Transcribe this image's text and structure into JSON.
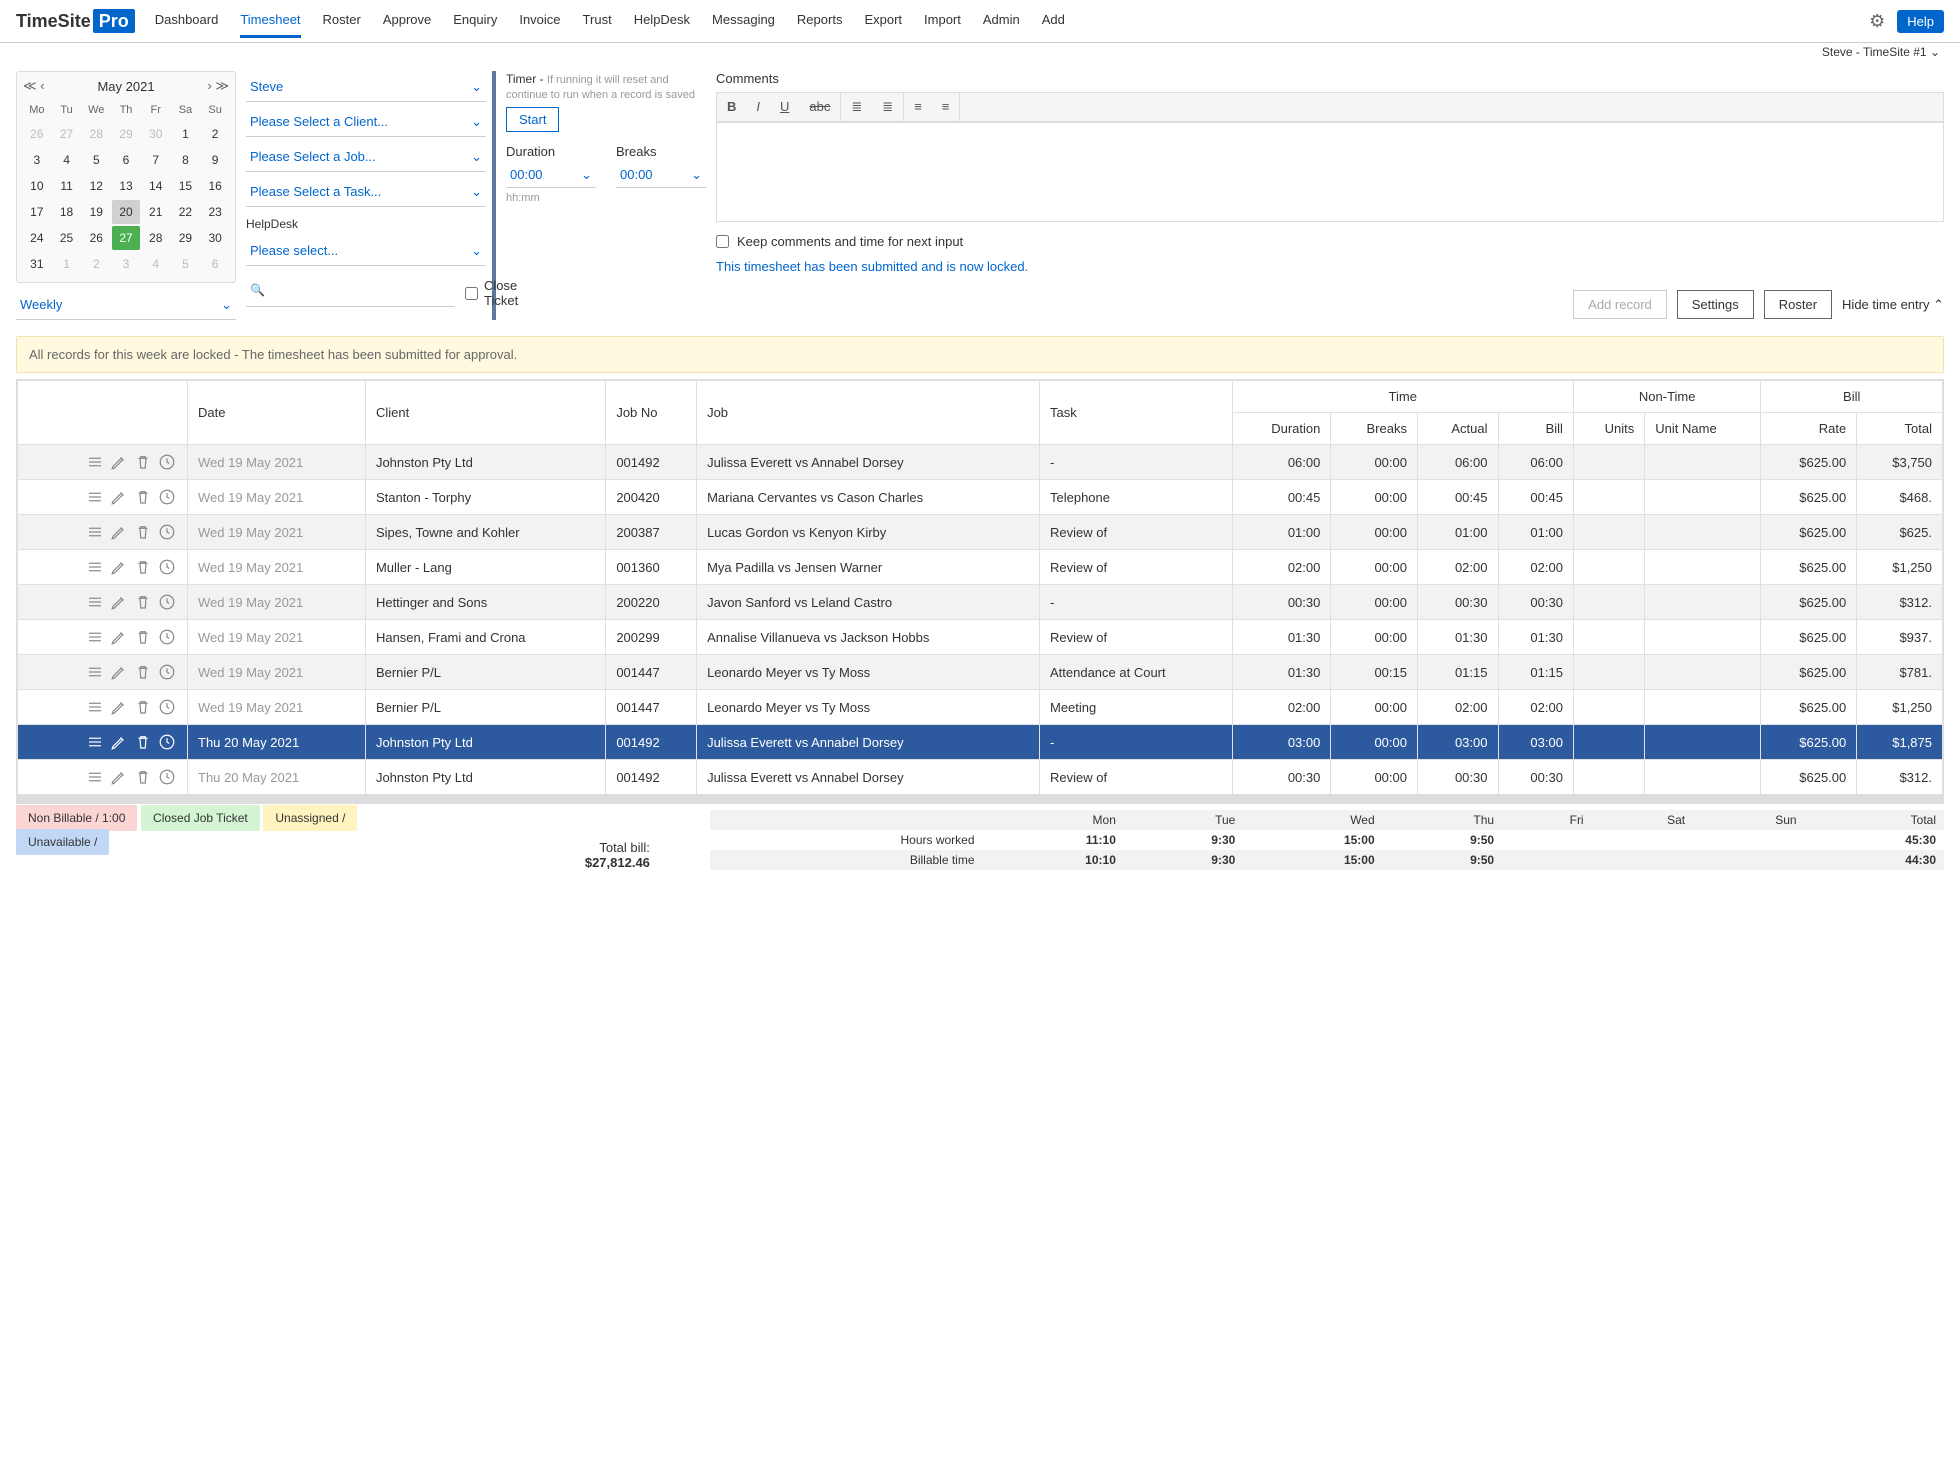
{
  "header": {
    "logo_a": "TimeSite",
    "logo_b": "Pro",
    "nav": [
      "Dashboard",
      "Timesheet",
      "Roster",
      "Approve",
      "Enquiry",
      "Invoice",
      "Trust",
      "HelpDesk",
      "Messaging",
      "Reports",
      "Export",
      "Import",
      "Admin",
      "Add"
    ],
    "active_nav": "Timesheet",
    "help": "Help",
    "user": "Steve - TimeSite #1"
  },
  "calendar": {
    "title": "May 2021",
    "dow": [
      "Mo",
      "Tu",
      "We",
      "Th",
      "Fr",
      "Sa",
      "Su"
    ],
    "rows": [
      [
        {
          "d": "26",
          "o": true
        },
        {
          "d": "27",
          "o": true
        },
        {
          "d": "28",
          "o": true
        },
        {
          "d": "29",
          "o": true
        },
        {
          "d": "30",
          "o": true
        },
        {
          "d": "1"
        },
        {
          "d": "2"
        }
      ],
      [
        {
          "d": "3"
        },
        {
          "d": "4"
        },
        {
          "d": "5"
        },
        {
          "d": "6"
        },
        {
          "d": "7"
        },
        {
          "d": "8"
        },
        {
          "d": "9"
        }
      ],
      [
        {
          "d": "10"
        },
        {
          "d": "11"
        },
        {
          "d": "12"
        },
        {
          "d": "13"
        },
        {
          "d": "14"
        },
        {
          "d": "15"
        },
        {
          "d": "16"
        }
      ],
      [
        {
          "d": "17"
        },
        {
          "d": "18"
        },
        {
          "d": "19"
        },
        {
          "d": "20",
          "hl": true
        },
        {
          "d": "21"
        },
        {
          "d": "22"
        },
        {
          "d": "23"
        }
      ],
      [
        {
          "d": "24"
        },
        {
          "d": "25"
        },
        {
          "d": "26"
        },
        {
          "d": "27",
          "td": true
        },
        {
          "d": "28"
        },
        {
          "d": "29"
        },
        {
          "d": "30"
        }
      ],
      [
        {
          "d": "31"
        },
        {
          "d": "1",
          "o": true
        },
        {
          "d": "2",
          "o": true
        },
        {
          "d": "3",
          "o": true
        },
        {
          "d": "4",
          "o": true
        },
        {
          "d": "5",
          "o": true
        },
        {
          "d": "6",
          "o": true
        }
      ]
    ],
    "weekly": "Weekly"
  },
  "selectors": {
    "person": "Steve",
    "client": "Please Select a Client...",
    "job": "Please Select a Job...",
    "task": "Please Select a Task...",
    "helpdesk_label": "HelpDesk",
    "helpdesk": "Please select...",
    "close_ticket": "Close Ticket"
  },
  "timer": {
    "label": "Timer - ",
    "desc": "If running it will reset and continue to run when a record is saved",
    "start": "Start",
    "duration_label": "Duration",
    "duration_val": "00:00",
    "breaks_label": "Breaks",
    "breaks_val": "00:00",
    "hhmm": "hh:mm"
  },
  "comments": {
    "label": "Comments",
    "keep": "Keep comments and time for next input",
    "locked": "This timesheet has been submitted and is now locked.",
    "add_record": "Add record",
    "settings": "Settings",
    "roster": "Roster",
    "hide": "Hide time entry"
  },
  "banner": "All records for this week are locked - The timesheet has been submitted for approval.",
  "columns": {
    "date": "Date",
    "client": "Client",
    "jobno": "Job No",
    "job": "Job",
    "task": "Task",
    "time": "Time",
    "nontime": "Non-Time",
    "bill": "Bill",
    "duration": "Duration",
    "breaks": "Breaks",
    "actual": "Actual",
    "billcol": "Bill",
    "units": "Units",
    "unitname": "Unit Name",
    "rate": "Rate",
    "total": "Total"
  },
  "rows": [
    {
      "date": "Wed 19 May 2021",
      "client": "Johnston Pty Ltd",
      "jobno": "001492",
      "job": "Julissa Everett vs Annabel Dorsey",
      "task": "-",
      "dur": "06:00",
      "brk": "00:00",
      "act": "06:00",
      "bill": "06:00",
      "units": "",
      "un": "",
      "rate": "$625.00",
      "total": "$3,750"
    },
    {
      "date": "Wed 19 May 2021",
      "client": "Stanton - Torphy",
      "jobno": "200420",
      "job": "Mariana Cervantes vs Cason Charles",
      "task": "Telephone",
      "dur": "00:45",
      "brk": "00:00",
      "act": "00:45",
      "bill": "00:45",
      "units": "",
      "un": "",
      "rate": "$625.00",
      "total": "$468."
    },
    {
      "date": "Wed 19 May 2021",
      "client": "Sipes, Towne and Kohler",
      "jobno": "200387",
      "job": "Lucas Gordon vs Kenyon Kirby",
      "task": "Review of",
      "dur": "01:00",
      "brk": "00:00",
      "act": "01:00",
      "bill": "01:00",
      "units": "",
      "un": "",
      "rate": "$625.00",
      "total": "$625."
    },
    {
      "date": "Wed 19 May 2021",
      "client": "Muller - Lang",
      "jobno": "001360",
      "job": "Mya Padilla vs Jensen Warner",
      "task": "Review of",
      "dur": "02:00",
      "brk": "00:00",
      "act": "02:00",
      "bill": "02:00",
      "units": "",
      "un": "",
      "rate": "$625.00",
      "total": "$1,250"
    },
    {
      "date": "Wed 19 May 2021",
      "client": "Hettinger and Sons",
      "jobno": "200220",
      "job": "Javon Sanford vs Leland Castro",
      "task": "-",
      "dur": "00:30",
      "brk": "00:00",
      "act": "00:30",
      "bill": "00:30",
      "units": "",
      "un": "",
      "rate": "$625.00",
      "total": "$312."
    },
    {
      "date": "Wed 19 May 2021",
      "client": "Hansen, Frami and Crona",
      "jobno": "200299",
      "job": "Annalise Villanueva vs Jackson Hobbs",
      "task": "Review of",
      "dur": "01:30",
      "brk": "00:00",
      "act": "01:30",
      "bill": "01:30",
      "units": "",
      "un": "",
      "rate": "$625.00",
      "total": "$937."
    },
    {
      "date": "Wed 19 May 2021",
      "client": "Bernier P/L",
      "jobno": "001447",
      "job": "Leonardo Meyer vs Ty Moss",
      "task": "Attendance at Court",
      "dur": "01:30",
      "brk": "00:15",
      "act": "01:15",
      "bill": "01:15",
      "units": "",
      "un": "",
      "rate": "$625.00",
      "total": "$781."
    },
    {
      "date": "Wed 19 May 2021",
      "client": "Bernier P/L",
      "jobno": "001447",
      "job": "Leonardo Meyer vs Ty Moss",
      "task": "Meeting",
      "dur": "02:00",
      "brk": "00:00",
      "act": "02:00",
      "bill": "02:00",
      "units": "",
      "un": "",
      "rate": "$625.00",
      "total": "$1,250"
    },
    {
      "date": "Thu 20 May 2021",
      "client": "Johnston Pty Ltd",
      "jobno": "001492",
      "job": "Julissa Everett vs Annabel Dorsey",
      "task": "-",
      "dur": "03:00",
      "brk": "00:00",
      "act": "03:00",
      "bill": "03:00",
      "units": "",
      "un": "",
      "rate": "$625.00",
      "total": "$1,875",
      "selected": true
    },
    {
      "date": "Thu 20 May 2021",
      "client": "Johnston Pty Ltd",
      "jobno": "001492",
      "job": "Julissa Everett vs Annabel Dorsey",
      "task": "Review of",
      "dur": "00:30",
      "brk": "00:00",
      "act": "00:30",
      "bill": "00:30",
      "units": "",
      "un": "",
      "rate": "$625.00",
      "total": "$312."
    }
  ],
  "legend": {
    "nonbill": "Non Billable / 1:00",
    "closed": "Closed Job Ticket",
    "unassigned": "Unassigned /",
    "unavailable": "Unavailable /"
  },
  "totals": {
    "total_bill_label": "Total bill:",
    "total_bill": "$27,812.46",
    "days": [
      "Mon",
      "Tue",
      "Wed",
      "Thu",
      "Fri",
      "Sat",
      "Sun",
      "Total"
    ],
    "worked_label": "Hours worked",
    "worked": [
      "11:10",
      "9:30",
      "15:00",
      "9:50",
      "",
      "",
      "",
      "45:30"
    ],
    "billable_label": "Billable time",
    "billable": [
      "10:10",
      "9:30",
      "15:00",
      "9:50",
      "",
      "",
      "",
      "44:30"
    ]
  }
}
